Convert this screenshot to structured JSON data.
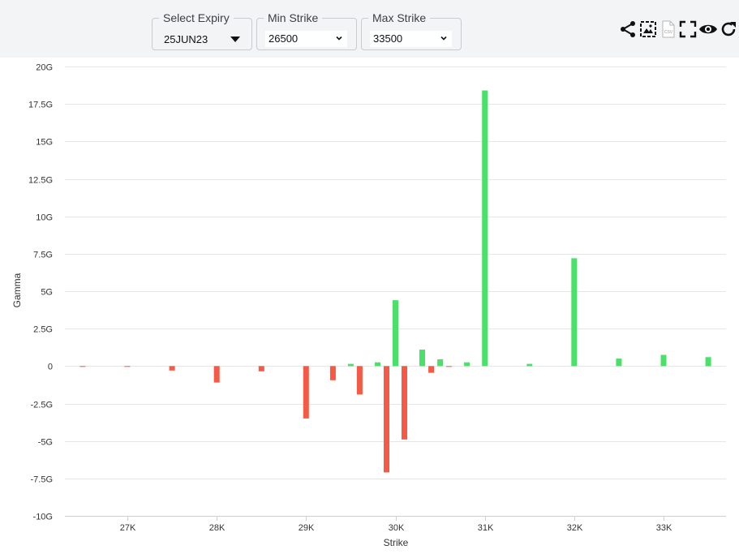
{
  "controls": {
    "expiry": {
      "label": "Select Expiry",
      "value": "25JUN23"
    },
    "min_strike": {
      "label": "Min Strike",
      "value": "26500"
    },
    "max_strike": {
      "label": "Max Strike",
      "value": "33500"
    }
  },
  "toolbar_icons": [
    "share-icon",
    "image-export-icon",
    "csv-export-icon",
    "fullscreen-icon",
    "eye-icon",
    "refresh-icon"
  ],
  "csv_icon_text": "CSV",
  "colors": {
    "positive": "#4be06a",
    "negative": "#f45a45",
    "grid": "#e6e6e6",
    "axis_text": "#333333"
  },
  "chart_data": {
    "type": "bar",
    "xlabel": "Strike",
    "ylabel": "Gamma",
    "ylim": [
      -10,
      20
    ],
    "xlim": [
      26500,
      33700
    ],
    "y_unit": "G",
    "y_ticks": [
      20,
      17.5,
      15,
      12.5,
      10,
      7.5,
      5,
      2.5,
      0,
      -2.5,
      -5,
      -7.5,
      -10
    ],
    "y_tick_labels": [
      "20G",
      "17.5G",
      "15G",
      "12.5G",
      "10G",
      "7.5G",
      "5G",
      "2.5G",
      "0",
      "-2.5G",
      "-5G",
      "-7.5G",
      "-10G"
    ],
    "x_ticks": [
      27000,
      28000,
      29000,
      30000,
      31000,
      32000,
      33000
    ],
    "x_tick_labels": [
      "27K",
      "28K",
      "29K",
      "30K",
      "31K",
      "32K",
      "33K"
    ],
    "grid": true,
    "legend": "none",
    "strikes": [
      26500,
      27000,
      27500,
      28000,
      28500,
      29000,
      29300,
      29500,
      29600,
      29800,
      29900,
      30000,
      30100,
      30300,
      30400,
      30500,
      30600,
      30800,
      31000,
      31500,
      32000,
      32500,
      33000,
      33500
    ],
    "values": [
      -0.05,
      -0.05,
      -0.3,
      -1.1,
      -0.35,
      -3.5,
      -0.95,
      0.15,
      -1.9,
      0.25,
      -7.1,
      4.4,
      -4.9,
      1.1,
      -0.45,
      0.45,
      -0.05,
      0.25,
      18.4,
      0.15,
      7.2,
      0.5,
      0.75,
      0.6
    ]
  }
}
